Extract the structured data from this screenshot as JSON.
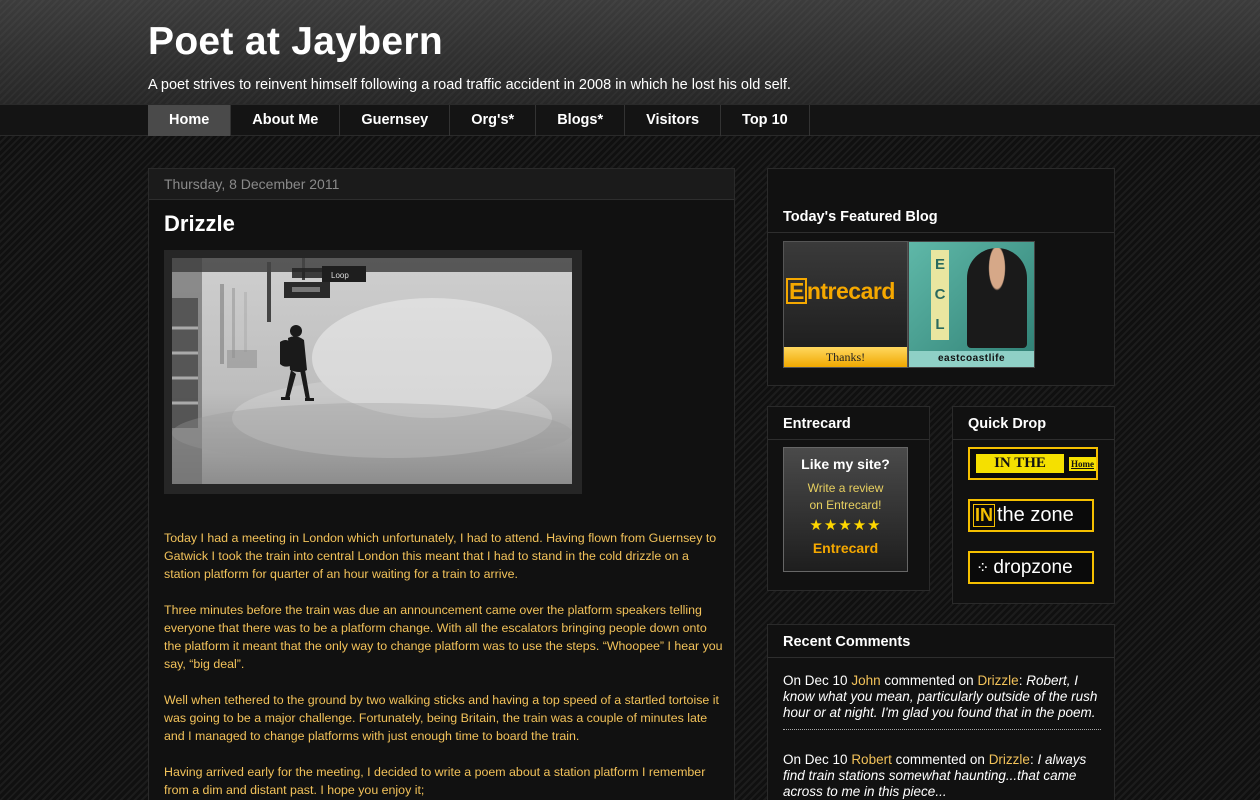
{
  "header": {
    "title": "Poet at Jaybern",
    "description": "A poet strives to reinvent himself following a road traffic accident in 2008 in which he lost his old self."
  },
  "nav": {
    "tabs": [
      "Home",
      "About Me",
      "Guernsey",
      "Org's*",
      "Blogs*",
      "Visitors",
      "Top 10"
    ],
    "active_index": 0
  },
  "post": {
    "date": "Thursday, 8 December 2011",
    "title": "Drizzle",
    "image_sign": "Loop",
    "paragraphs": [
      "Today I had a meeting in London which unfortunately, I had to attend.  Having flown from Guernsey to Gatwick I took the train into central London this meant that I had to stand in the cold drizzle on a station platform for quarter of an hour waiting for a train to arrive.",
      "Three minutes before the train was due an announcement came over the platform speakers telling everyone that there was to be a platform change.  With all the escalators bringing people down onto the platform it meant that the only way to change platform was to use the steps. “Whoopee” I hear you say, “big deal”.",
      "Well when tethered to the ground by two walking sticks and having a top speed of a startled tortoise it was going to be a major challenge.  Fortunately, being Britain, the train was a couple of minutes late and I managed to change platforms with just enough time to board the train.",
      "Having arrived early for the meeting, I decided to write a poem about a station platform I remember from a dim and distant past.  I hope you enjoy it;"
    ]
  },
  "featured": {
    "title": "Today's Featured Blog",
    "logo_e": "E",
    "logo_rest": "ntrecard",
    "thanks": "Thanks!",
    "ecl_letters": [
      "E",
      "C",
      "L"
    ],
    "ecl_label": "eastcoastlife"
  },
  "entrecard": {
    "title": "Entrecard",
    "like_title": "Like my site?",
    "like_sub_1": "Write a review",
    "like_sub_2": "on Entrecard!",
    "stars": "★★★★★",
    "mini_logo": "Entrecard"
  },
  "quickdrop": {
    "title": "Quick Drop",
    "inthe": "IN THE",
    "home": "Home",
    "zone_in": "IN",
    "zone_rest": "the zone",
    "dz_icon": "⁘",
    "dropzone": "dropzone"
  },
  "comments": {
    "title": "Recent Comments",
    "items": [
      {
        "prefix": "On Dec 10",
        "author": "John",
        "mid": "commented on",
        "post": "Drizzle",
        "excerpt": "Robert, I know what you mean, particularly outside of the rush hour or at night. I'm glad you found that in the poem."
      },
      {
        "prefix": "On Dec 10",
        "author": "Robert",
        "mid": "commented on",
        "post": "Drizzle",
        "excerpt": "I always find train stations somewhat haunting...that came across to me in this piece..."
      }
    ]
  },
  "colors": {
    "accent_text": "#f2c25a",
    "entrecard_orange": "#f5a800",
    "nav_active": "#4a4a4a"
  }
}
